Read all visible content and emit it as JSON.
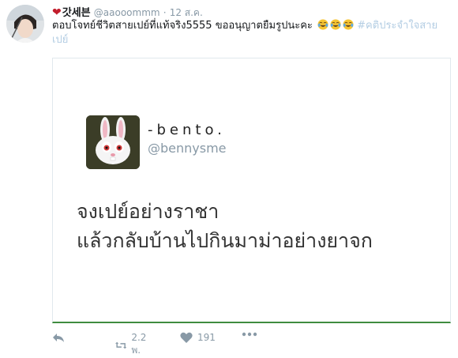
{
  "tweet": {
    "display_name": "갓세븐",
    "handle": "@aaooommm",
    "separator": "·",
    "date": "12 ส.ค.",
    "text": "ตอบโจทย์ชีวิตสายเปย์ที่แท้จริง5555 ขออนุญาตยืมรูปนะคะ",
    "emoji": [
      "tears-of-joy",
      "tears-of-joy",
      "tears-of-joy"
    ],
    "hashtag": "#คติประจำใจสายเปย์"
  },
  "media": {
    "name": "-bento.",
    "handle": "@bennysme",
    "line1": "จงเปย์อย่างราชา",
    "line2": "แล้วกลับบ้านไปกินมาม่าอย่างยาจก"
  },
  "actions": {
    "retweet_count": "2.2 พ.",
    "like_count": "191",
    "icons": [
      "reply-icon",
      "retweet-icon",
      "like-icon",
      "more-icon"
    ]
  },
  "colors": {
    "accent": "#b3cde3",
    "heart": "#c21d2c",
    "muted": "#8899a6",
    "border_bottom": "#3f8c3f"
  }
}
